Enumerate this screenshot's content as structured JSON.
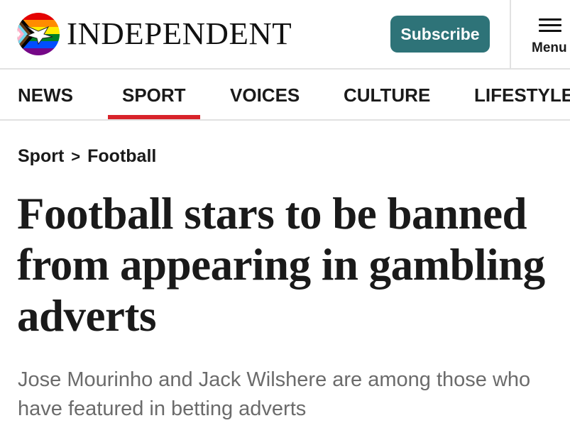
{
  "header": {
    "logo_text": "INDEPENDENT",
    "subscribe_label": "Subscribe",
    "menu_label": "Menu",
    "accent_color": "#2e7378"
  },
  "nav": {
    "items": [
      "NEWS",
      "SPORT",
      "VOICES",
      "CULTURE",
      "LIFESTYLE"
    ],
    "active": "SPORT",
    "active_color": "#d8232a"
  },
  "breadcrumb": {
    "section": "Sport",
    "separator": ">",
    "subsection": "Football"
  },
  "article": {
    "headline": "Football stars to be banned from appearing in gambling adverts",
    "standfirst": "Jose Mourinho and Jack Wilshere are among those who have featured in betting adverts"
  }
}
